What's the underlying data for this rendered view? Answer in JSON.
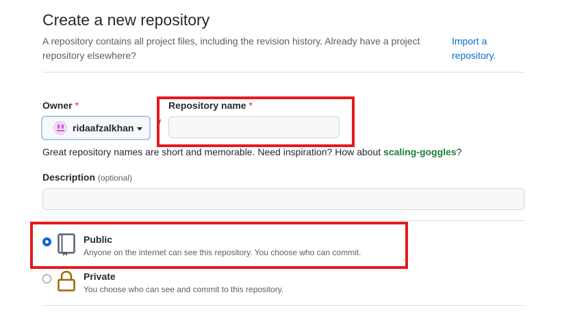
{
  "header": {
    "title": "Create a new repository",
    "subtitle": "A repository contains all project files, including the revision history. Already have a project repository elsewhere?",
    "import_link": "Import a repository."
  },
  "owner": {
    "label": "Owner",
    "required_mark": "*",
    "selected": "ridaafzalkhan",
    "avatar_icon": "identicon-avatar"
  },
  "repo_name": {
    "label": "Repository name",
    "required_mark": "*",
    "value": "",
    "separator": "/"
  },
  "name_hint": {
    "text": "Great repository names are short and memorable. Need inspiration? How about ",
    "suggestion": "scaling-goggles",
    "end": "?"
  },
  "description": {
    "label": "Description",
    "optional_text": "(optional)",
    "value": ""
  },
  "visibility": {
    "options": [
      {
        "title": "Public",
        "description": "Anyone on the internet can see this repository. You choose who can commit.",
        "selected": true,
        "icon": "repo-book-icon"
      },
      {
        "title": "Private",
        "description": "You choose who can see and commit to this repository.",
        "selected": false,
        "icon": "lock-icon"
      }
    ]
  },
  "colors": {
    "highlight_box": "#e3191e",
    "link": "#0969da",
    "suggestion": "#1a7f37",
    "required": "#cf222e",
    "radio_selected": "#0a66d6",
    "lock": "#9a6700"
  }
}
